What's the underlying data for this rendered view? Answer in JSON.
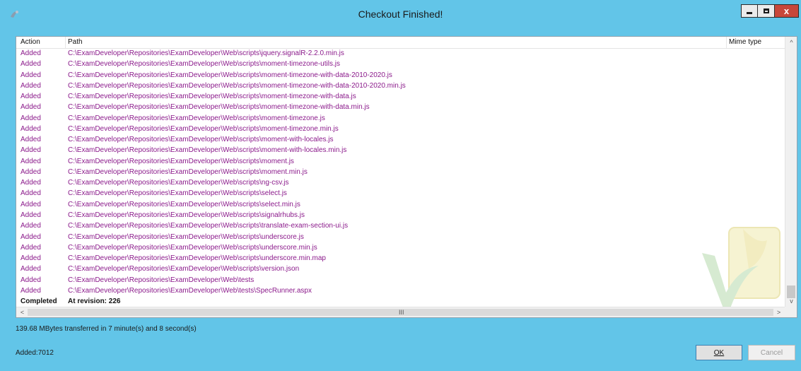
{
  "window": {
    "title": "Checkout Finished!",
    "close_label": "x",
    "icon": "tortoisesvn-icon"
  },
  "table": {
    "columns": {
      "action": "Action",
      "path": "Path",
      "mime": "Mime type"
    },
    "rows": [
      {
        "action": "Added",
        "path": "C:\\ExamDeveloper\\Repositories\\ExamDeveloper\\Web\\scripts\\jquery.signalR-2.2.0.min.js"
      },
      {
        "action": "Added",
        "path": "C:\\ExamDeveloper\\Repositories\\ExamDeveloper\\Web\\scripts\\moment-timezone-utils.js"
      },
      {
        "action": "Added",
        "path": "C:\\ExamDeveloper\\Repositories\\ExamDeveloper\\Web\\scripts\\moment-timezone-with-data-2010-2020.js"
      },
      {
        "action": "Added",
        "path": "C:\\ExamDeveloper\\Repositories\\ExamDeveloper\\Web\\scripts\\moment-timezone-with-data-2010-2020.min.js"
      },
      {
        "action": "Added",
        "path": "C:\\ExamDeveloper\\Repositories\\ExamDeveloper\\Web\\scripts\\moment-timezone-with-data.js"
      },
      {
        "action": "Added",
        "path": "C:\\ExamDeveloper\\Repositories\\ExamDeveloper\\Web\\scripts\\moment-timezone-with-data.min.js"
      },
      {
        "action": "Added",
        "path": "C:\\ExamDeveloper\\Repositories\\ExamDeveloper\\Web\\scripts\\moment-timezone.js"
      },
      {
        "action": "Added",
        "path": "C:\\ExamDeveloper\\Repositories\\ExamDeveloper\\Web\\scripts\\moment-timezone.min.js"
      },
      {
        "action": "Added",
        "path": "C:\\ExamDeveloper\\Repositories\\ExamDeveloper\\Web\\scripts\\moment-with-locales.js"
      },
      {
        "action": "Added",
        "path": "C:\\ExamDeveloper\\Repositories\\ExamDeveloper\\Web\\scripts\\moment-with-locales.min.js"
      },
      {
        "action": "Added",
        "path": "C:\\ExamDeveloper\\Repositories\\ExamDeveloper\\Web\\scripts\\moment.js"
      },
      {
        "action": "Added",
        "path": "C:\\ExamDeveloper\\Repositories\\ExamDeveloper\\Web\\scripts\\moment.min.js"
      },
      {
        "action": "Added",
        "path": "C:\\ExamDeveloper\\Repositories\\ExamDeveloper\\Web\\scripts\\ng-csv.js"
      },
      {
        "action": "Added",
        "path": "C:\\ExamDeveloper\\Repositories\\ExamDeveloper\\Web\\scripts\\select.js"
      },
      {
        "action": "Added",
        "path": "C:\\ExamDeveloper\\Repositories\\ExamDeveloper\\Web\\scripts\\select.min.js"
      },
      {
        "action": "Added",
        "path": "C:\\ExamDeveloper\\Repositories\\ExamDeveloper\\Web\\scripts\\signalrhubs.js"
      },
      {
        "action": "Added",
        "path": "C:\\ExamDeveloper\\Repositories\\ExamDeveloper\\Web\\scripts\\translate-exam-section-ui.js"
      },
      {
        "action": "Added",
        "path": "C:\\ExamDeveloper\\Repositories\\ExamDeveloper\\Web\\scripts\\underscore.js"
      },
      {
        "action": "Added",
        "path": "C:\\ExamDeveloper\\Repositories\\ExamDeveloper\\Web\\scripts\\underscore.min.js"
      },
      {
        "action": "Added",
        "path": "C:\\ExamDeveloper\\Repositories\\ExamDeveloper\\Web\\scripts\\underscore.min.map"
      },
      {
        "action": "Added",
        "path": "C:\\ExamDeveloper\\Repositories\\ExamDeveloper\\Web\\scripts\\version.json"
      },
      {
        "action": "Added",
        "path": "C:\\ExamDeveloper\\Repositories\\ExamDeveloper\\Web\\tests"
      },
      {
        "action": "Added",
        "path": "C:\\ExamDeveloper\\Repositories\\ExamDeveloper\\Web\\tests\\SpecRunner.aspx"
      },
      {
        "action": "Completed",
        "path": "At revision: 226"
      }
    ],
    "scroll": {
      "up_arrow": "^",
      "down_arrow": "v",
      "left_arrow": "<",
      "right_arrow": ">",
      "grip": "III"
    }
  },
  "status": {
    "transfer": "139.68 MBytes transferred in 7 minute(s) and 8 second(s)",
    "added": "Added:7012"
  },
  "buttons": {
    "ok": "OK",
    "cancel": "Cancel"
  },
  "colors": {
    "background": "#62c5e8",
    "added_text": "#8b1a8b",
    "close_button": "#c7473a"
  }
}
